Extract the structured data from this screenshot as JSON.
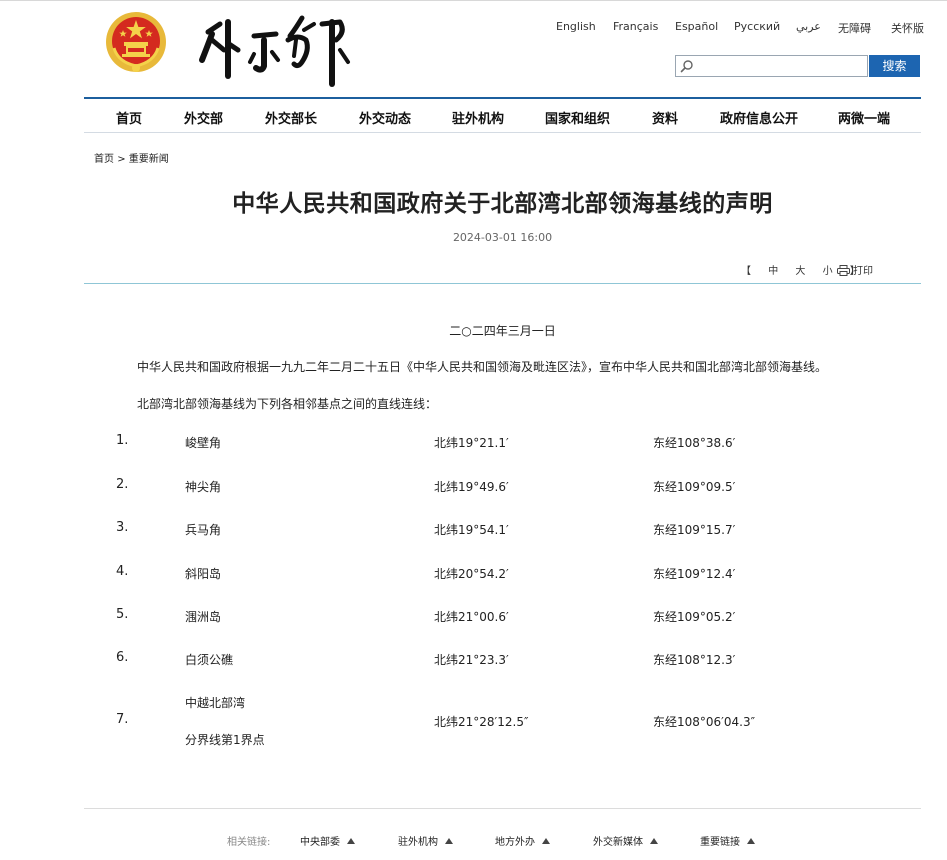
{
  "languages": [
    "English",
    "Français",
    "Español",
    "Русский",
    "عربي",
    "无障碍",
    "关怀版"
  ],
  "search": {
    "placeholder": "",
    "button_label": "搜索"
  },
  "nav": [
    "首页",
    "外交部",
    "外交部长",
    "外交动态",
    "驻外机构",
    "国家和组织",
    "资料",
    "政府信息公开",
    "两微一端"
  ],
  "breadcrumb": {
    "home": "首页",
    "sep": ">",
    "current": "重要新闻"
  },
  "article": {
    "title": "中华人民共和国政府关于北部湾北部领海基线的声明",
    "publish_date": "2024-03-01 16:00",
    "font_controls": {
      "open": "【",
      "mid": "中",
      "large": "大",
      "small": "小",
      "close": "】"
    },
    "print_label": "打印",
    "date_line": "二○二四年三月一日",
    "intro": "中华人民共和国政府根据一九九二年二月二十五日《中华人民共和国领海及毗连区法》，宣布中华人民共和国北部湾北部领海基线。",
    "list_intro": "北部湾北部领海基线为下列各相邻基点之间的直线连线：",
    "rows": [
      {
        "num": "1.",
        "name": "峻壁角",
        "lat": "北纬19°21.1′",
        "lng": "东经108°38.6′"
      },
      {
        "num": "2.",
        "name": "神尖角",
        "lat": "北纬19°49.6′",
        "lng": "东经109°09.5′"
      },
      {
        "num": "3.",
        "name": "兵马角",
        "lat": "北纬19°54.1′",
        "lng": "东经109°15.7′"
      },
      {
        "num": "4.",
        "name": "斜阳岛",
        "lat": "北纬20°54.2′",
        "lng": "东经109°12.4′"
      },
      {
        "num": "5.",
        "name": "涠洲岛",
        "lat": "北纬21°00.6′",
        "lng": "东经109°05.2′"
      },
      {
        "num": "6.",
        "name": "白须公礁",
        "lat": "北纬21°23.3′",
        "lng": "东经108°12.3′"
      },
      {
        "num": "7.",
        "name_line1": "中越北部湾",
        "name_line2": "分界线第1界点",
        "lat": "北纬21°28′12.5″",
        "lng": "东经108°06′04.3″"
      }
    ]
  },
  "footer": {
    "related_label": "相关链接:",
    "links": [
      "中央部委",
      "驻外机构",
      "地方外办",
      "外交新媒体",
      "重要链接"
    ]
  },
  "colors": {
    "accent_blue": "#1d65b1",
    "nav_rule": "#1c5f9e",
    "title_rule": "#8fc6d6",
    "emblem_red": "#d42a1f",
    "emblem_gold": "#e8b93a"
  }
}
